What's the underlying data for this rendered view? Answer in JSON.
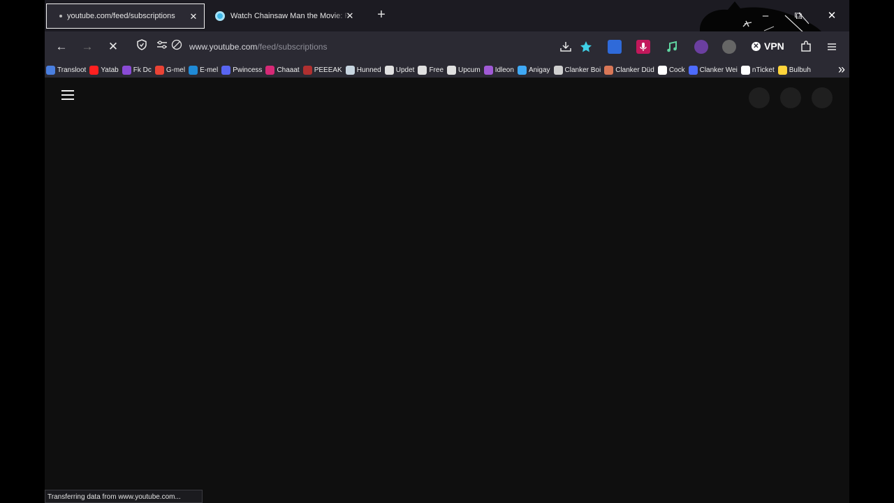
{
  "tabs": [
    {
      "title": "youtube.com/feed/subscriptions",
      "active": true
    },
    {
      "title": "Watch Chainsaw Man the Movie: Reze",
      "active": false
    }
  ],
  "navbar": {
    "url_host": "www.youtube.com",
    "url_path": "/feed/subscriptions",
    "vpn_label": "VPN"
  },
  "bookmarks": [
    {
      "label": "Transloot",
      "icon_color": "#4a7fe0"
    },
    {
      "label": "Yatab",
      "icon_color": "#ff2020"
    },
    {
      "label": "Fk Dc",
      "icon_color": "#8a4bd6"
    },
    {
      "label": "G-mel",
      "icon_color": "#ea4335"
    },
    {
      "label": "E-mel",
      "icon_color": "#1f8ad6"
    },
    {
      "label": "Pwincess",
      "icon_color": "#5865f2"
    },
    {
      "label": "Chaaat",
      "icon_color": "#d62976"
    },
    {
      "label": "PEEEAK",
      "icon_color": "#b03030"
    },
    {
      "label": "Hunned",
      "icon_color": "#c7d5e0"
    },
    {
      "label": "Updet",
      "icon_color": "#e0e0e0"
    },
    {
      "label": "Free",
      "icon_color": "#e0e0e0"
    },
    {
      "label": "Upcum",
      "icon_color": "#e0e0e0"
    },
    {
      "label": "Idleon",
      "icon_color": "#a05ad6"
    },
    {
      "label": "Anigay",
      "icon_color": "#3fa9f5"
    },
    {
      "label": "Clanker Boi",
      "icon_color": "#d0d0d0"
    },
    {
      "label": "Clanker Düd",
      "icon_color": "#d97757"
    },
    {
      "label": "Cock",
      "icon_color": "#ffffff"
    },
    {
      "label": "Clanker Wei",
      "icon_color": "#4d6bfe"
    },
    {
      "label": "nTicket",
      "icon_color": "#ffffff"
    },
    {
      "label": "Bulbuh",
      "icon_color": "#ffd43b"
    }
  ],
  "status_text": "Transferring data from www.youtube.com...",
  "colors": {
    "tab_strip_bg": "#1c1b22",
    "toolbar_bg": "#2b2a33",
    "page_bg": "#0f0f0f",
    "placeholder_circle": "#1f1f1f"
  }
}
